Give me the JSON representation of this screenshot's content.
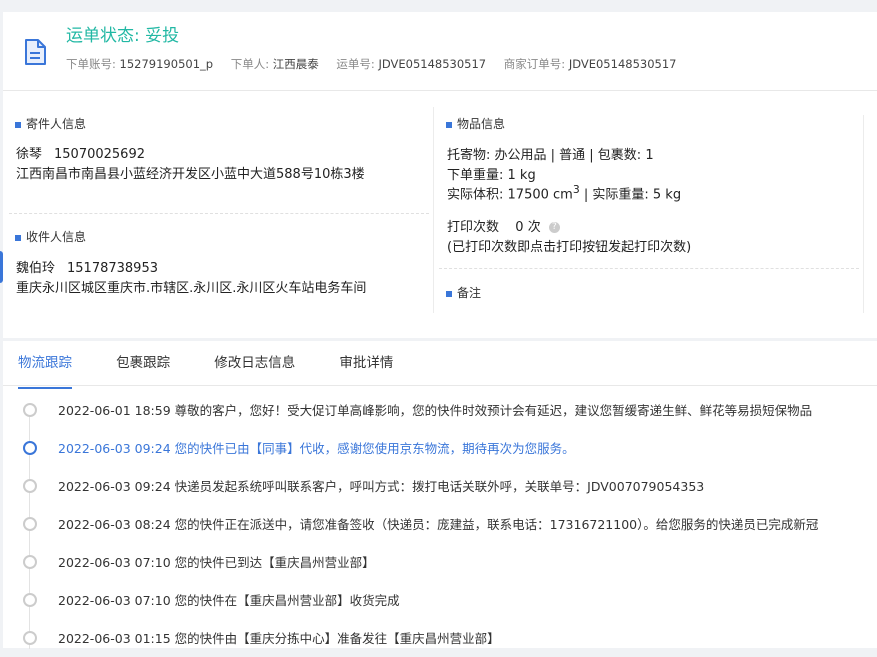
{
  "header": {
    "status_label": "运单状态: 妥投",
    "account_label": "下单账号:",
    "account_value": "15279190501_p",
    "orderer_label": "下单人:",
    "orderer_value": "江西晨泰",
    "waybill_label": "运单号:",
    "waybill_value": "JDVE05148530517",
    "merchant_order_label": "商家订单号:",
    "merchant_order_value": "JDVE05148530517"
  },
  "sender": {
    "title": "寄件人信息",
    "name": "徐琴",
    "phone": "15070025692",
    "address": "江西南昌市南昌县小蓝经济开发区小蓝中大道588号10栋3楼"
  },
  "receiver": {
    "title": "收件人信息",
    "name": "魏伯玲",
    "phone": "15178738953",
    "address": "重庆永川区城区重庆市.市辖区.永川区.永川区火车站电务车间"
  },
  "goods": {
    "title": "物品信息",
    "line1": "托寄物:  办公用品 | 普通  |  包裹数:  1",
    "weight_line": "下单重量:  1 kg",
    "volume_label": "实际体积:",
    "volume_value": "17500 cm",
    "volume_sup": "3",
    "actual_weight": " | 实际重量:  5 kg",
    "print_count_label": "打印次数",
    "print_count_value": "0 次",
    "print_note": "(已打印次数即点击打印按钮发起打印次数)",
    "help_glyph": "?"
  },
  "remarks": {
    "title": "备注"
  },
  "tabs": [
    {
      "label": "物流跟踪",
      "active": true
    },
    {
      "label": "包裹跟踪"
    },
    {
      "label": "修改日志信息"
    },
    {
      "label": "审批详情"
    }
  ],
  "timeline": [
    {
      "time": "2022-06-01 18:59",
      "text": "尊敬的客户，您好！受大促订单高峰影响，您的快件时效预计会有延迟，建议您暂缓寄递生鲜、鲜花等易损短保物品"
    },
    {
      "time": "2022-06-03 09:24",
      "text": "您的快件已由【同事】代收，感谢您使用京东物流，期待再次为您服务。",
      "active": true
    },
    {
      "time": "2022-06-03 09:24",
      "text": "快递员发起系统呼叫联系客户，呼叫方式：拨打电话关联外呼，关联单号：JDV007079054353"
    },
    {
      "time": "2022-06-03 08:24",
      "text": "您的快件正在派送中，请您准备签收（快递员：庞建益，联系电话：17316721100）。给您服务的快递员已完成新冠"
    },
    {
      "time": "2022-06-03 07:10",
      "text": "您的快件已到达【重庆昌州营业部】"
    },
    {
      "time": "2022-06-03 07:10",
      "text": "您的快件在【重庆昌州营业部】收货完成"
    },
    {
      "time": "2022-06-03 01:15",
      "text": "您的快件由【重庆分拣中心】准备发往【重庆昌州营业部】"
    }
  ],
  "colors": {
    "accent": "#3a76d9",
    "status": "#22b8a4"
  }
}
